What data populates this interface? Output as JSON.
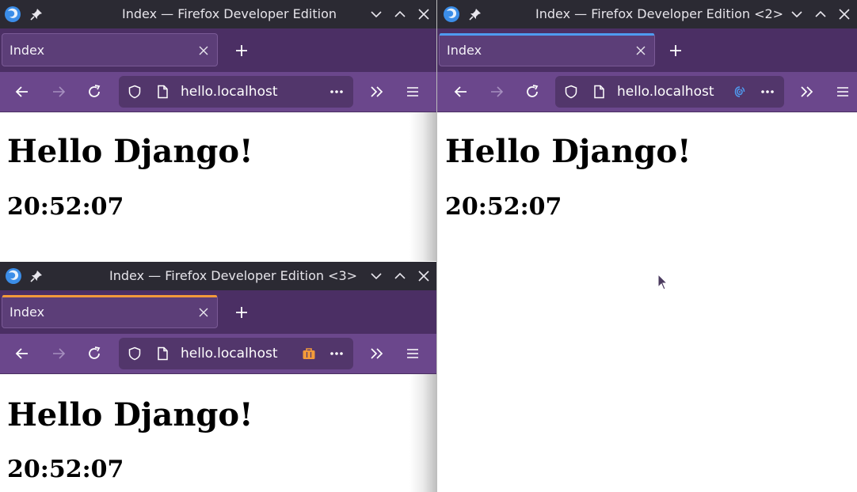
{
  "windows": [
    {
      "title": "Index — Firefox Developer Edition",
      "tab_label": "Index",
      "url": "hello.localhost",
      "heading": "Hello Django!",
      "time": "20:52:07",
      "tab_accent_color": "",
      "container_icon": "none"
    },
    {
      "title": "Index — Firefox Developer Edition <2>",
      "tab_label": "Index",
      "url": "hello.localhost",
      "heading": "Hello Django!",
      "time": "20:52:07",
      "tab_accent_color": "#4f9bf0",
      "container_icon": "fingerprint-icon"
    },
    {
      "title": "Index — Firefox Developer Edition <3>",
      "tab_label": "Index",
      "url": "hello.localhost",
      "heading": "Hello Django!",
      "time": "20:52:07",
      "tab_accent_color": "#f29a3a",
      "container_icon": "briefcase-icon"
    }
  ],
  "colors": {
    "titlebar": "#2b2a33",
    "tabbar": "#4b2f64",
    "navbar": "#6b478c",
    "urlbar": "#52366b",
    "container_blue": "#4f9bf0",
    "container_orange": "#f29a3a"
  }
}
